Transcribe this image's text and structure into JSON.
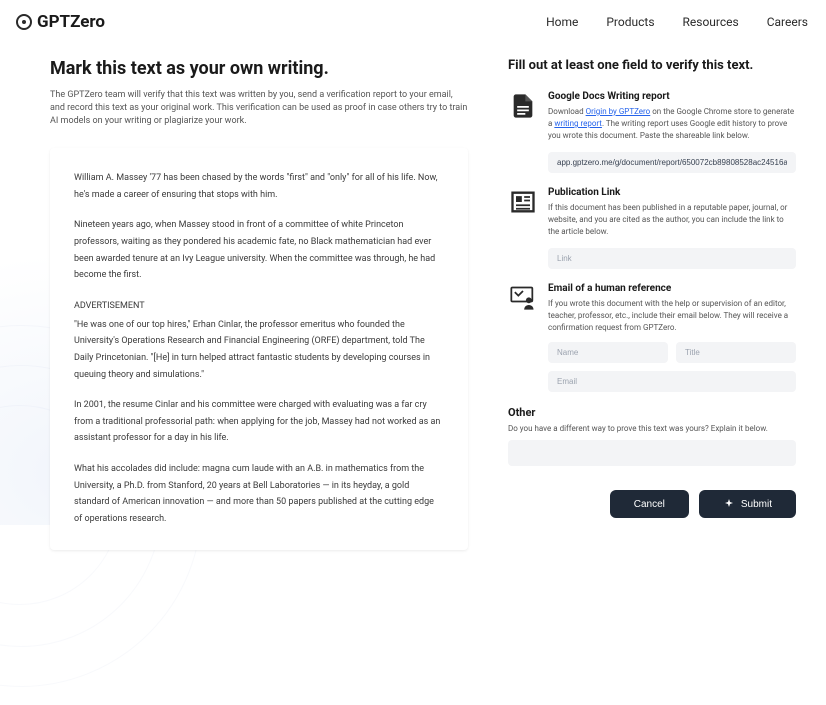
{
  "brand": "GPTZero",
  "nav": [
    "Home",
    "Products",
    "Resources",
    "Careers"
  ],
  "heading": "Mark this text as your own writing.",
  "subtitle": "The GPTZero team will verify that this text was written by you, send a verification report to your email, and record this text as your original work. This verification can be used as proof in case others try to train AI models on your writing or plagiarize your work.",
  "doc": {
    "p1": "William A. Massey '77 has been chased by the words \"first\" and \"only\" for all of his life. Now, he's made a career of ensuring that stops with him.",
    "p2": "Nineteen years ago, when Massey stood in front of a committee of white Princeton professors, waiting as they pondered his academic fate, no Black mathematician had ever been awarded tenure at an Ivy League university. When the committee was through, he had become the first.",
    "ad": "ADVERTISEMENT",
    "p3": "\"He was one of our top hires,\" Erhan Cinlar, the professor emeritus who founded the University's Operations Research and Financial Engineering (ORFE) department, told The Daily Princetonian. \"[He] in turn helped attract fantastic students by developing courses in queuing theory and simulations.\"",
    "p4": "In 2001, the resume Cinlar and his committee were charged with evaluating was a far cry from a traditional professorial path: when applying for the job, Massey had not worked as an assistant professor for a day in his life.",
    "p5": "What his accolades did include: magna cum laude with an A.B. in mathematics from the University, a Ph.D. from Stanford, 20 years at Bell Laboratories — in its heyday, a gold standard of American innovation — and more than 50 papers published at the cutting edge of operations research."
  },
  "form_heading": "Fill out at least one field to verify this text.",
  "gdocs": {
    "title": "Google Docs Writing report",
    "desc_pre": "Download ",
    "link_text": "Origin by GPTZero",
    "desc_mid": " on the Google Chrome store to generate a ",
    "link2_text": "writing report",
    "desc_post": ". The writing report uses Google edit history to prove you wrote this document. Paste the shareable link below.",
    "value": "app.gptzero.me/g/document/report/650072cb89808528ac24516a"
  },
  "pub": {
    "title": "Publication Link",
    "desc": "If this document has been published in a reputable paper, journal, or website, and you are cited as the author, you can include the link to the article below.",
    "placeholder": "Link"
  },
  "human": {
    "title": "Email of a human reference",
    "desc": "If you wrote this document with the help or supervision of an editor, teacher, professor, etc., include their email below. They will receive a confirmation request from GPTZero.",
    "name_ph": "Name",
    "title_ph": "Title",
    "email_ph": "Email"
  },
  "other": {
    "title": "Other",
    "desc": "Do you have a different way to prove this text was yours? Explain it below."
  },
  "buttons": {
    "cancel": "Cancel",
    "submit": "Submit"
  }
}
